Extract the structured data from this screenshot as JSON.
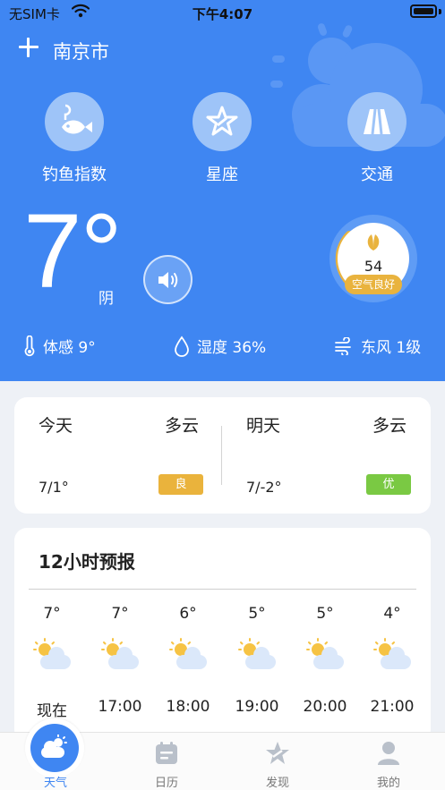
{
  "status_bar": {
    "carrier": "无SIM卡",
    "time": "下午4:07"
  },
  "location": {
    "city": "南京市"
  },
  "shortcuts": [
    {
      "label": "钓鱼指数",
      "icon": "fishing-icon"
    },
    {
      "label": "星座",
      "icon": "constellation-star-icon"
    },
    {
      "label": "交通",
      "icon": "road-icon"
    }
  ],
  "current": {
    "temperature": "7°",
    "condition": "阴",
    "aqi_value": "54",
    "aqi_label": "空气良好",
    "feels_like": "体感 9°",
    "humidity": "湿度 36%",
    "wind": "东风 1级"
  },
  "days": [
    {
      "label": "今天",
      "condition": "多云",
      "range": "7/1°",
      "quality": "良",
      "quality_color": "#eab33c"
    },
    {
      "label": "明天",
      "condition": "多云",
      "range": "7/-2°",
      "quality": "优",
      "quality_color": "#7ac943"
    }
  ],
  "forecast": {
    "title": "12小时预报",
    "hours": [
      {
        "time": "现在",
        "temp": "7°",
        "icon": "partly-cloudy-icon"
      },
      {
        "time": "17:00",
        "temp": "7°",
        "icon": "partly-cloudy-icon"
      },
      {
        "time": "18:00",
        "temp": "6°",
        "icon": "partly-cloudy-icon"
      },
      {
        "time": "19:00",
        "temp": "5°",
        "icon": "partly-cloudy-icon"
      },
      {
        "time": "20:00",
        "temp": "5°",
        "icon": "partly-cloudy-icon"
      },
      {
        "time": "21:00",
        "temp": "4°",
        "icon": "partly-cloudy-icon"
      }
    ]
  },
  "tabs": [
    {
      "label": "天气",
      "icon": "weather-icon",
      "active": true
    },
    {
      "label": "日历",
      "icon": "calendar-icon",
      "active": false
    },
    {
      "label": "发现",
      "icon": "discover-star-icon",
      "active": false
    },
    {
      "label": "我的",
      "icon": "profile-icon",
      "active": false
    }
  ],
  "colors": {
    "accent": "#3f86f2",
    "aqi_good": "#e9b33e"
  }
}
